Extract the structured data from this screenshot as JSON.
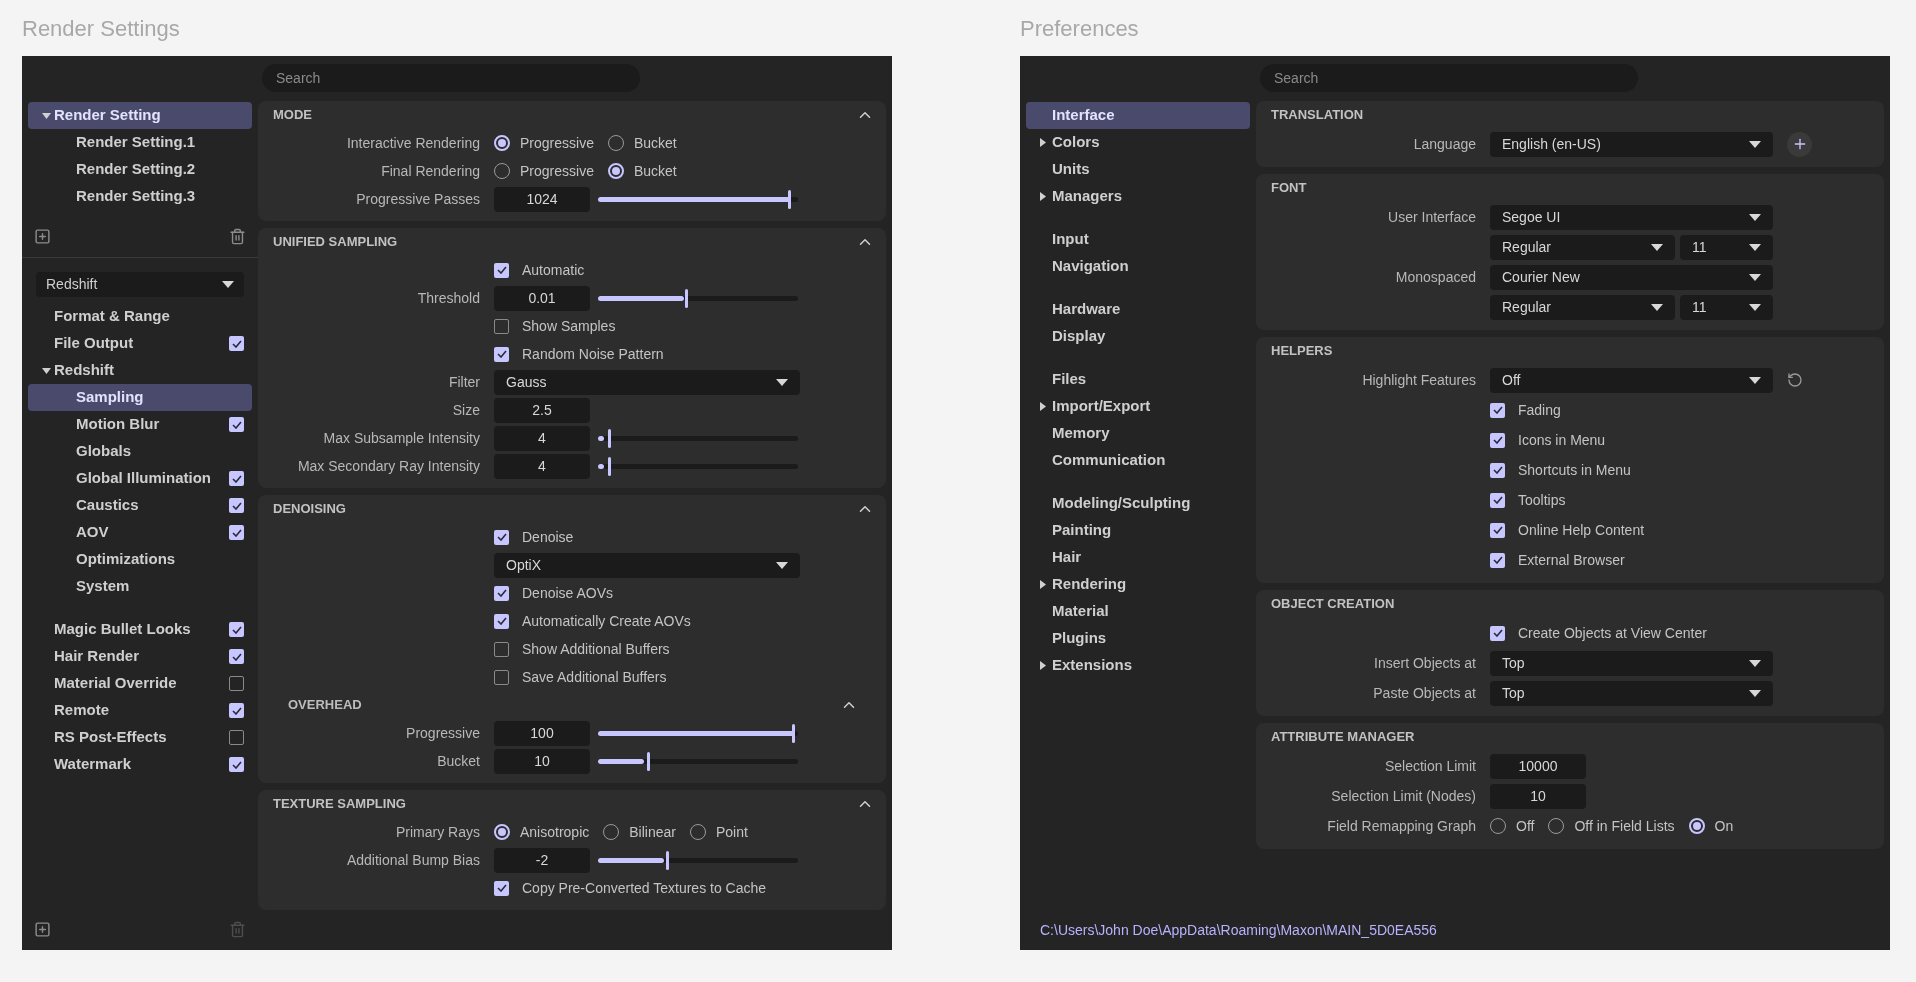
{
  "panels": [
    {
      "title": "Render Settings",
      "sidebar": {
        "tree": [
          {
            "label": "Render Setting",
            "selected": true,
            "expanded": true,
            "children": [
              {
                "label": "Render Setting.1",
                "selected": false
              },
              {
                "label": "Render Setting.2",
                "selected": false
              },
              {
                "label": "Render Setting.3",
                "selected": false
              }
            ]
          }
        ],
        "renderer": "Redshift",
        "groups": [
          [
            {
              "label": "Format & Range",
              "selected": false
            },
            {
              "label": "File Output",
              "selected": false,
              "checked": true
            },
            {
              "label": "Redshift",
              "selected": false,
              "expanded": true,
              "children": [
                {
                  "label": "Sampling",
                  "selected": true
                },
                {
                  "label": "Motion Blur",
                  "selected": false,
                  "checked": true
                },
                {
                  "label": "Globals",
                  "selected": false
                },
                {
                  "label": "Global Illumination",
                  "selected": false,
                  "checked": true
                },
                {
                  "label": "Caustics",
                  "selected": false,
                  "checked": true
                },
                {
                  "label": "AOV",
                  "selected": false,
                  "checked": true
                },
                {
                  "label": "Optimizations",
                  "selected": false
                },
                {
                  "label": "System",
                  "selected": false
                }
              ]
            }
          ],
          [
            {
              "label": "Magic Bullet Looks",
              "selected": false,
              "checked": true
            },
            {
              "label": "Hair Render",
              "selected": false,
              "checked": true
            },
            {
              "label": "Material Override",
              "selected": false,
              "checked": false
            },
            {
              "label": "Remote",
              "selected": false,
              "checked": true
            },
            {
              "label": "RS Post-Effects",
              "selected": false,
              "checked": false
            },
            {
              "label": "Watermark",
              "selected": false,
              "checked": true
            }
          ]
        ]
      },
      "search": {
        "placeholder": "Search"
      },
      "sections": [
        {
          "title": "MODE",
          "expanded": true,
          "rows": [
            {
              "kind": "radio",
              "label": "Interactive Rendering",
              "options": [
                {
                  "label": "Progressive",
                  "selected": true
                },
                {
                  "label": "Bucket",
                  "selected": false
                }
              ]
            },
            {
              "kind": "radio",
              "label": "Final Rendering",
              "options": [
                {
                  "label": "Progressive",
                  "selected": false
                },
                {
                  "label": "Bucket",
                  "selected": true
                }
              ]
            },
            {
              "kind": "slider",
              "label": "Progressive Passes",
              "value": "1024",
              "level": 0.98
            }
          ]
        },
        {
          "title": "UNIFIED SAMPLING",
          "expanded": true,
          "rows": [
            {
              "kind": "check",
              "text": "Automatic",
              "checked": true
            },
            {
              "kind": "slider",
              "label": "Threshold",
              "value": "0.01",
              "level": 0.45
            },
            {
              "kind": "check",
              "text": "Show Samples",
              "checked": false
            },
            {
              "kind": "check",
              "text": "Random Noise Pattern",
              "checked": true
            },
            {
              "kind": "dropdown",
              "label": "Filter",
              "value": "Gauss"
            },
            {
              "kind": "number",
              "label": "Size",
              "value": "2.5"
            },
            {
              "kind": "slider",
              "label": "Max Subsample Intensity",
              "value": "4",
              "level": 0.05
            },
            {
              "kind": "slider",
              "label": "Max Secondary Ray Intensity",
              "value": "4",
              "level": 0.05
            }
          ]
        },
        {
          "title": "DENOISING",
          "expanded": true,
          "rows": [
            {
              "kind": "check",
              "text": "Denoise",
              "checked": true
            },
            {
              "kind": "dropdown",
              "value": "OptiX"
            },
            {
              "kind": "check",
              "text": "Denoise AOVs",
              "checked": true
            },
            {
              "kind": "check",
              "text": "Automatically Create AOVs",
              "checked": true
            },
            {
              "kind": "check",
              "text": "Show Additional Buffers",
              "checked": false
            },
            {
              "kind": "check",
              "text": "Save Additional Buffers",
              "checked": false
            },
            {
              "kind": "subheading",
              "text": "OVERHEAD",
              "expanded": true
            },
            {
              "kind": "slider",
              "label": "Progressive",
              "value": "100",
              "level": 1.0
            },
            {
              "kind": "slider",
              "label": "Bucket",
              "value": "10",
              "level": 0.25
            }
          ]
        },
        {
          "title": "TEXTURE SAMPLING",
          "expanded": true,
          "rows": [
            {
              "kind": "radio",
              "label": "Primary Rays",
              "options": [
                {
                  "label": "Anisotropic",
                  "selected": true
                },
                {
                  "label": "Bilinear",
                  "selected": false
                },
                {
                  "label": "Point",
                  "selected": false
                }
              ]
            },
            {
              "kind": "slider",
              "label": "Additional Bump Bias",
              "value": "-2",
              "level": 0.35
            },
            {
              "kind": "check",
              "text": "Copy Pre-Converted Textures to Cache",
              "checked": true
            }
          ]
        }
      ]
    },
    {
      "title": "Preferences",
      "sidebar": {
        "groups": [
          [
            {
              "label": "Interface",
              "selected": true
            },
            {
              "label": "Colors",
              "selected": false,
              "expanded": false
            },
            {
              "label": "Units",
              "selected": false
            },
            {
              "label": "Managers",
              "selected": false,
              "expanded": false
            }
          ],
          [
            {
              "label": "Input",
              "selected": false
            },
            {
              "label": "Navigation",
              "selected": false
            }
          ],
          [
            {
              "label": "Hardware",
              "selected": false
            },
            {
              "label": "Display",
              "selected": false
            }
          ],
          [
            {
              "label": "Files",
              "selected": false
            },
            {
              "label": "Import/Export",
              "selected": false,
              "expanded": false
            },
            {
              "label": "Memory",
              "selected": false
            },
            {
              "label": "Communication",
              "selected": false
            }
          ],
          [
            {
              "label": "Modeling/Sculpting",
              "selected": false
            },
            {
              "label": "Painting",
              "selected": false
            },
            {
              "label": "Hair",
              "selected": false
            },
            {
              "label": "Rendering",
              "selected": false,
              "expanded": false
            },
            {
              "label": "Material",
              "selected": false
            },
            {
              "label": "Plugins",
              "selected": false
            },
            {
              "label": "Extensions",
              "selected": false,
              "expanded": false
            }
          ]
        ]
      },
      "search": {
        "placeholder": "Search"
      },
      "sections": [
        {
          "title": "TRANSLATION",
          "rows": [
            {
              "kind": "dropdown",
              "label": "Language",
              "value": "English (en-US)",
              "add_button": true
            }
          ]
        },
        {
          "title": "FONT",
          "rows": [
            {
              "kind": "dropdown",
              "label": "User Interface",
              "value": "Segoe UI"
            },
            {
              "kind": "dropdown_pair",
              "values": [
                "Regular",
                "11"
              ]
            },
            {
              "kind": "dropdown",
              "label": "Monospaced",
              "value": "Courier New"
            },
            {
              "kind": "dropdown_pair",
              "values": [
                "Regular",
                "11"
              ]
            }
          ]
        },
        {
          "title": "HELPERS",
          "rows": [
            {
              "kind": "dropdown",
              "label": "Highlight Features",
              "value": "Off",
              "reset_button": true
            },
            {
              "kind": "check",
              "text": "Fading",
              "checked": true
            },
            {
              "kind": "check",
              "text": "Icons in Menu",
              "checked": true
            },
            {
              "kind": "check",
              "text": "Shortcuts in Menu",
              "checked": true
            },
            {
              "kind": "check",
              "text": "Tooltips",
              "checked": true
            },
            {
              "kind": "check",
              "text": "Online Help Content",
              "checked": true
            },
            {
              "kind": "check",
              "text": "External Browser",
              "checked": true
            }
          ]
        },
        {
          "title": "OBJECT CREATION",
          "rows": [
            {
              "kind": "check",
              "text": "Create Objects at View Center",
              "checked": true
            },
            {
              "kind": "dropdown",
              "label": "Insert Objects at",
              "value": "Top"
            },
            {
              "kind": "dropdown",
              "label": "Paste Objects at",
              "value": "Top"
            }
          ]
        },
        {
          "title": "ATTRIBUTE MANAGER",
          "rows": [
            {
              "kind": "number",
              "label": "Selection Limit",
              "value": "10000"
            },
            {
              "kind": "number",
              "label": "Selection Limit (Nodes)",
              "value": "10"
            },
            {
              "kind": "radio",
              "label": "Field Remapping Graph",
              "options": [
                {
                  "label": "Off",
                  "selected": false
                },
                {
                  "label": "Off in Field Lists",
                  "selected": false
                },
                {
                  "label": "On",
                  "selected": true
                }
              ]
            }
          ]
        }
      ],
      "footer_path": "C:\\Users\\John Doe\\AppData\\Roaming\\Maxon\\MAIN_5D0EA556"
    }
  ]
}
